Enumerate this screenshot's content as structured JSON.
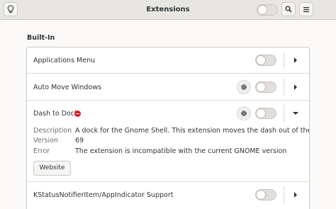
{
  "window": {
    "title": "Extensions"
  },
  "header": {
    "left_icon": "lightbulb-icon",
    "global_toggle_state": "off",
    "search_icon": "search-icon",
    "menu_icon": "hamburger-menu-icon"
  },
  "section": {
    "title": "Built-In"
  },
  "extensions": [
    {
      "name": "Applications Menu",
      "enabled": false,
      "has_settings": false,
      "expanded": false
    },
    {
      "name": "Auto Move Windows",
      "enabled": false,
      "has_settings": true,
      "expanded": false
    },
    {
      "name": "Dash to Dock",
      "enabled": false,
      "has_settings": true,
      "expanded": true,
      "has_error": true,
      "details": {
        "description_label": "Description",
        "description": "A dock for the Gnome Shell. This extension moves the dash out of the overview tra...",
        "version_label": "Version",
        "version": "69",
        "error_label": "Error",
        "error": "The extension is incompatible with the current GNOME version",
        "website_label": "Website"
      }
    },
    {
      "name": "KStatusNotifierItem/AppIndicator Support",
      "enabled": false,
      "has_settings": false,
      "expanded": false
    }
  ],
  "colors": {
    "error": "#e01b24",
    "headerbar": "#e8e6e3",
    "background": "#faf9f8"
  }
}
